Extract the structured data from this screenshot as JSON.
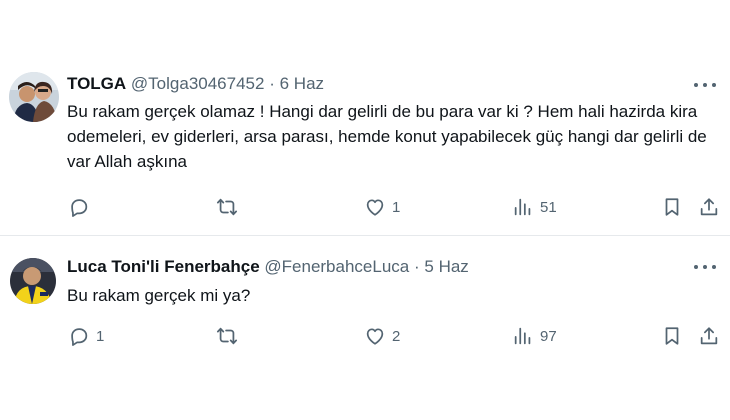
{
  "tweets": [
    {
      "display_name": "TOLGA",
      "handle": "@Tolga30467452",
      "separator": "·",
      "date": "6 Haz",
      "text": "Bu rakam gerçek olamaz ! Hangi dar gelirli de bu para var ki ? Hem hali hazirda kira odemeleri, ev giderleri, arsa parası, hemde konut yapabilecek güç hangi dar gelirli de var Allah aşkına",
      "replies": "",
      "retweets": "",
      "likes": "1",
      "views": "51"
    },
    {
      "display_name": "Luca Toni'li Fenerbahçe",
      "handle": "@FenerbahceLuca",
      "separator": "·",
      "date": "5 Haz",
      "text": "Bu rakam gerçek mi ya?",
      "replies": "1",
      "retweets": "",
      "likes": "2",
      "views": "97"
    }
  ],
  "icons": {
    "reply": "reply-icon",
    "retweet": "retweet-icon",
    "like": "heart-icon",
    "views": "views-icon",
    "bookmark": "bookmark-icon",
    "share": "share-icon",
    "more": "more-icon"
  },
  "colors": {
    "text_primary": "#0f1419",
    "text_secondary": "#536471",
    "divider": "#e6e9ec"
  }
}
